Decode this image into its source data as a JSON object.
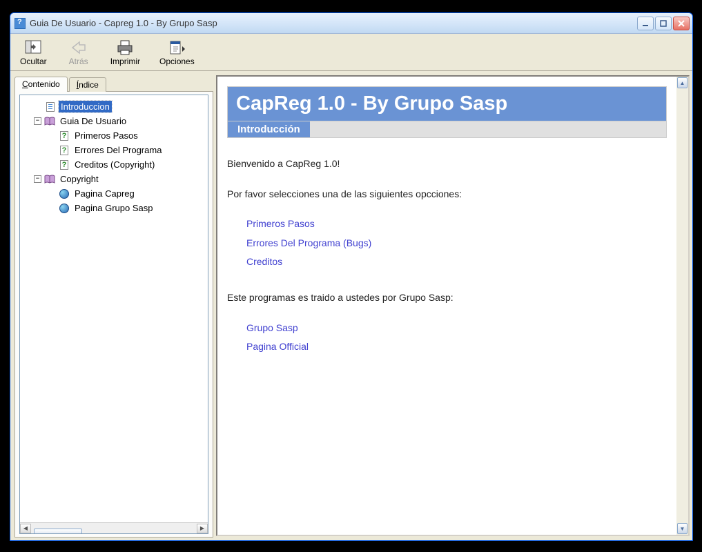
{
  "window": {
    "title": "Guia De Usuario - Capreg 1.0 - By Grupo Sasp"
  },
  "toolbar": {
    "hide": "Ocultar",
    "back": "Atrás",
    "print": "Imprimir",
    "options": "Opciones"
  },
  "tabs": {
    "contents": "Contenido",
    "index": "Índice"
  },
  "tree": {
    "intro": "Introduccion",
    "guide": "Guia De Usuario",
    "firstSteps": "Primeros Pasos",
    "errors": "Errores Del Programa",
    "credits": "Creditos (Copyright)",
    "copyright": "Copyright",
    "pageCapreg": "Pagina Capreg",
    "pageGrupo": "Pagina Grupo Sasp"
  },
  "content": {
    "title": "CapReg 1.0 - By Grupo Sasp",
    "subtitle": "Introducción",
    "welcome": "Bienvenido a CapReg 1.0!",
    "prompt1": "Por favor selecciones una de las siguientes opcciones:",
    "links1": {
      "a": "Primeros Pasos",
      "b": "Errores Del Programa (Bugs)",
      "c": "Creditos"
    },
    "prompt2": "Este programas es traido a ustedes por Grupo Sasp:",
    "links2": {
      "a": "Grupo Sasp",
      "b": "Pagina Official"
    }
  }
}
